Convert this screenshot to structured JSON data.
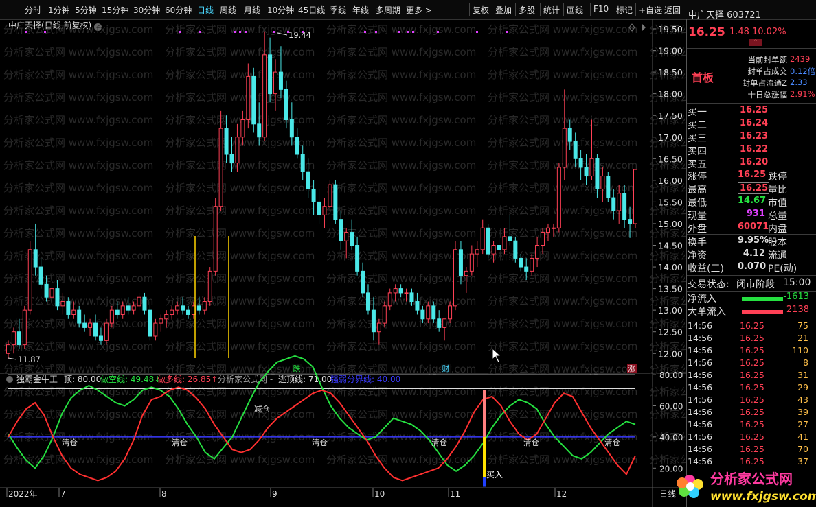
{
  "toolbar": {
    "periods": [
      "分时",
      "1分钟",
      "5分钟",
      "15分钟",
      "30分钟",
      "60分钟",
      "日线",
      "周线",
      "月线",
      "10分钟",
      "45日线",
      "季线",
      "年线",
      "多周期",
      "更多 >"
    ],
    "active_period": "日线",
    "right_buttons": [
      "复权",
      "叠加",
      "多股",
      "统计",
      "画线",
      "F10",
      "标记",
      "+自选",
      "返回"
    ]
  },
  "main_chart": {
    "title": "中广天择(日线,前复权)",
    "high_label": "19.44",
    "low_label": "11.87",
    "price_ticks": [
      "19.50",
      "19.00",
      "18.50",
      "18.00",
      "17.50",
      "17.00",
      "16.50",
      "16.00",
      "15.50",
      "15.00",
      "14.50",
      "14.00",
      "13.50",
      "13.00",
      "12.50",
      "12.00"
    ],
    "markers": {
      "die": "跌",
      "cai": "财",
      "zhang": "涨"
    },
    "watermark": "分析家公式网  www.fxjgsw.com"
  },
  "indicator": {
    "name": "独霸金牛王",
    "items": [
      {
        "label": "顶: 80.00",
        "color": "#dddddd"
      },
      {
        "label": "做空线: 49.48↓",
        "color": "#25e040"
      },
      {
        "label": "做多线: 26.85↑",
        "color": "#ff4055"
      },
      {
        "label": "分析家公式网 -",
        "color": "#999999"
      },
      {
        "label": "逃顶线: 71.00",
        "color": "#dddddd"
      },
      {
        "label": "强弱分界线: 40.00",
        "color": "#3a3aff"
      }
    ],
    "ticks": [
      "80.00",
      "60.00",
      "40.00",
      "20.00"
    ],
    "labels": {
      "jiancang": "减仓",
      "qingcang": "清仓",
      "mairu": "买入"
    }
  },
  "date_axis": {
    "labels": [
      "2022年",
      "7",
      "8",
      "9",
      "10",
      "11",
      "12"
    ],
    "right": "日线"
  },
  "quote": {
    "name": "中广天择",
    "code": "603721",
    "price": "16.25",
    "change": "1.48",
    "pct": "10.02%",
    "board": "首板",
    "seal": [
      {
        "label": "当前封单额",
        "value": "2439"
      },
      {
        "label": "封单占成交",
        "value": "0.12倍"
      },
      {
        "label": "封单占流通Z",
        "value": "2.33"
      },
      {
        "label": "十日总涨幅",
        "value": "2.91%"
      }
    ],
    "bids": [
      {
        "label": "买一",
        "price": "16.25"
      },
      {
        "label": "买二",
        "price": "16.24"
      },
      {
        "label": "买三",
        "price": "16.23"
      },
      {
        "label": "买四",
        "price": "16.22"
      },
      {
        "label": "买五",
        "price": "16.20"
      }
    ],
    "stats": [
      {
        "l1": "涨停",
        "v1": "16.25",
        "c1": "red",
        "l2": "跌停"
      },
      {
        "l1": "最高",
        "v1": "16.25",
        "c1": "red",
        "l2": "量比"
      },
      {
        "l1": "最低",
        "v1": "14.67",
        "c1": "green",
        "l2": "市值"
      },
      {
        "l1": "现量",
        "v1": "931",
        "c1": "mag",
        "l2": "总量"
      },
      {
        "l1": "外盘",
        "v1": "60071",
        "c1": "red",
        "l2": "内盘"
      }
    ],
    "stats2": [
      {
        "l1": "换手",
        "v1": "9.95%",
        "l2": "股本"
      },
      {
        "l1": "净资",
        "v1": "4.12",
        "l2": "流通"
      },
      {
        "l1": "收益(三)",
        "v1": "0.070",
        "l2": "PE(动)"
      }
    ],
    "trade_status": {
      "label": "交易状态:",
      "value": "闭市阶段",
      "time": "15:00"
    },
    "flows": [
      {
        "label": "净流入",
        "value": "-1613",
        "color": "#25e040"
      },
      {
        "label": "大单流入",
        "value": "2138",
        "color": "#ff4055"
      }
    ],
    "ticks": [
      {
        "t": "14:56",
        "p": "16.25",
        "v": "75"
      },
      {
        "t": "14:56",
        "p": "16.25",
        "v": "21"
      },
      {
        "t": "14:56",
        "p": "16.25",
        "v": "110"
      },
      {
        "t": "14:56",
        "p": "16.25",
        "v": "8"
      },
      {
        "t": "14:56",
        "p": "16.25",
        "v": "31"
      },
      {
        "t": "14:56",
        "p": "16.25",
        "v": "29"
      },
      {
        "t": "14:56",
        "p": "16.25",
        "v": "43"
      },
      {
        "t": "14:56",
        "p": "16.25",
        "v": "39"
      },
      {
        "t": "14:56",
        "p": "16.25",
        "v": "27"
      },
      {
        "t": "14:56",
        "p": "16.25",
        "v": "41"
      },
      {
        "t": "14:56",
        "p": "16.25",
        "v": "70"
      },
      {
        "t": "14:56",
        "p": "16.25",
        "v": "37"
      }
    ]
  },
  "logo": {
    "text": "分析家公式网",
    "url": "www.fxjgsw.com"
  }
}
